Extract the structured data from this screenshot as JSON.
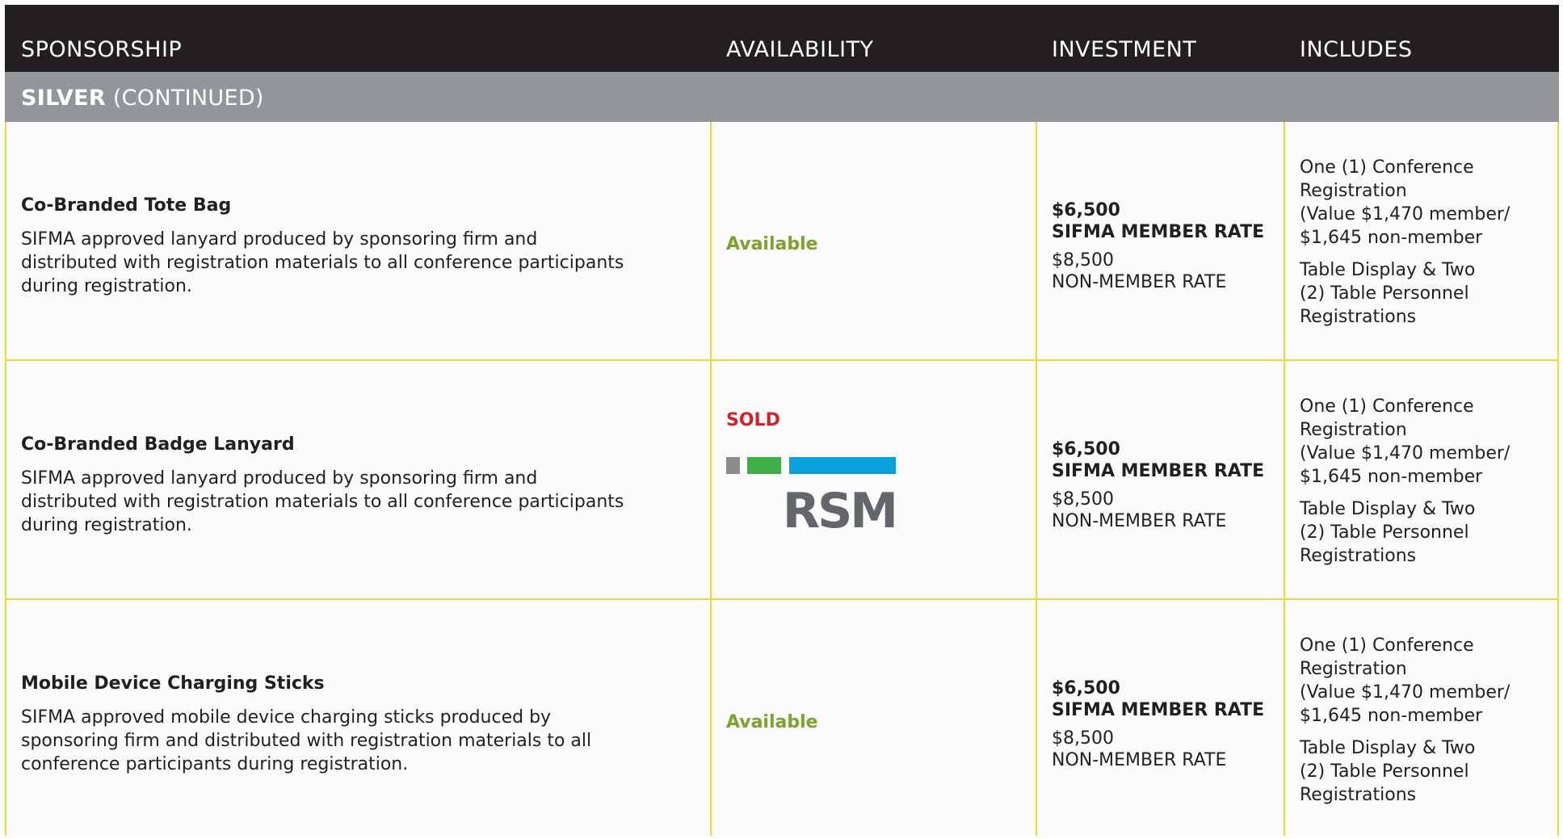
{
  "header": {
    "col1": "SPONSORSHIP",
    "col2": "AVAILABILITY",
    "col3": "INVESTMENT",
    "col4": "INCLUDES"
  },
  "section": {
    "tier": "SILVER",
    "suffix": "(CONTINUED)"
  },
  "rows": [
    {
      "title": "Co-Branded Tote Bag",
      "desc_lines": [
        "SIFMA approved lanyard produced by sponsoring firm and",
        "distributed with registration materials to all conference participants",
        "during registration."
      ],
      "availability": "Available",
      "member_price": "$6,500",
      "member_label": "SIFMA MEMBER RATE",
      "nonmember_price": "$8,500",
      "nonmember_label": "NON-MEMBER RATE",
      "includes_a": [
        "One (1) Conference",
        "Registration",
        "(Value $1,470 member/",
        "$1,645 non-member"
      ],
      "includes_b": [
        "Table Display & Two",
        "(2) Table Personnel",
        "Registrations"
      ]
    },
    {
      "title": "Co-Branded Badge Lanyard",
      "desc_lines": [
        "SIFMA approved lanyard produced by sponsoring firm and",
        "distributed with registration materials to all conference participants",
        "during registration."
      ],
      "availability": "SOLD",
      "sponsor_logo_text": "RSM",
      "member_price": "$6,500",
      "member_label": "SIFMA MEMBER RATE",
      "nonmember_price": "$8,500",
      "nonmember_label": "NON-MEMBER RATE",
      "includes_a": [
        "One (1) Conference",
        "Registration",
        "(Value $1,470 member/",
        "$1,645 non-member"
      ],
      "includes_b": [
        "Table Display & Two",
        "(2) Table Personnel",
        "Registrations"
      ]
    },
    {
      "title": "Mobile Device Charging Sticks",
      "desc_lines": [
        "SIFMA approved mobile device charging sticks produced by",
        "sponsoring firm and distributed with registration materials to all",
        "conference participants during registration."
      ],
      "availability": "Available",
      "member_price": "$6,500",
      "member_label": "SIFMA MEMBER RATE",
      "nonmember_price": "$8,500",
      "nonmember_label": "NON-MEMBER RATE",
      "includes_a": [
        "One (1) Conference",
        "Registration",
        "(Value $1,470 member/",
        "$1,645 non-member"
      ],
      "includes_b": [
        "Table Display & Two",
        "(2) Table Personnel",
        "Registrations"
      ]
    }
  ],
  "colors": {
    "header_bg": "#231f20",
    "subheader_bg": "#939598",
    "grid_line": "#eed93a",
    "available": "#7ba32e",
    "sold": "#d71f2b",
    "rsm_gray": "#8a8c8e",
    "rsm_green": "#3fae49",
    "rsm_blue": "#0aa0dc",
    "rsm_text": "#63666a"
  }
}
